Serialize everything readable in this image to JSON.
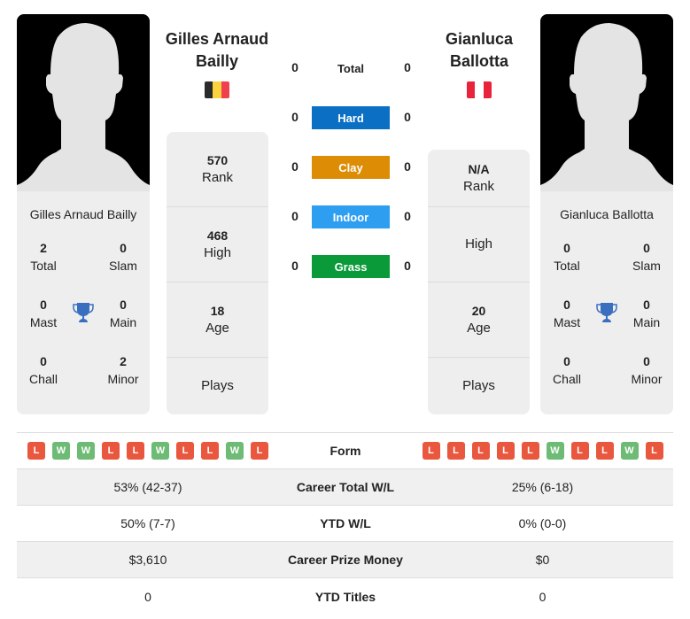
{
  "colors": {
    "hard": "#0b6fc4",
    "clay": "#dd8c05",
    "indoor": "#2e9ef0",
    "grass": "#0a9a3a",
    "win": "#6dbb75",
    "loss": "#e9573f",
    "trophy": "#3a6fbf"
  },
  "player1": {
    "name": "Gilles Arnaud Bailly",
    "name_line1": "Gilles Arnaud",
    "name_line2": "Bailly",
    "flag": "belgium-flag",
    "flag_colors": [
      "#2b2b2b",
      "#fbd33f",
      "#f0404f"
    ],
    "rank": "570",
    "rank_label": "Rank",
    "high": "468",
    "high_label": "High",
    "age": "18",
    "age_label": "Age",
    "plays": "",
    "plays_label": "Plays",
    "titles": {
      "total": "2",
      "total_label": "Total",
      "slam": "0",
      "slam_label": "Slam",
      "mast": "0",
      "mast_label": "Mast",
      "main": "0",
      "main_label": "Main",
      "chall": "0",
      "chall_label": "Chall",
      "minor": "2",
      "minor_label": "Minor"
    },
    "form": [
      "L",
      "W",
      "W",
      "L",
      "L",
      "W",
      "L",
      "L",
      "W",
      "L"
    ]
  },
  "player2": {
    "name": "Gianluca Ballotta",
    "name_line1": "Gianluca",
    "name_line2": "Ballotta",
    "flag": "peru-flag",
    "flag_colors": [
      "#e8233b",
      "#ffffff",
      "#e8233b"
    ],
    "rank": "N/A",
    "rank_label": "Rank",
    "high": "",
    "high_label": "High",
    "age": "20",
    "age_label": "Age",
    "plays": "",
    "plays_label": "Plays",
    "titles": {
      "total": "0",
      "total_label": "Total",
      "slam": "0",
      "slam_label": "Slam",
      "mast": "0",
      "mast_label": "Mast",
      "main": "0",
      "main_label": "Main",
      "chall": "0",
      "chall_label": "Chall",
      "minor": "0",
      "minor_label": "Minor"
    },
    "form": [
      "L",
      "L",
      "L",
      "L",
      "L",
      "W",
      "L",
      "L",
      "W",
      "L"
    ]
  },
  "h2h": {
    "total": {
      "label": "Total",
      "p1": "0",
      "p2": "0"
    },
    "hard": {
      "label": "Hard",
      "p1": "0",
      "p2": "0"
    },
    "clay": {
      "label": "Clay",
      "p1": "0",
      "p2": "0"
    },
    "indoor": {
      "label": "Indoor",
      "p1": "0",
      "p2": "0"
    },
    "grass": {
      "label": "Grass",
      "p1": "0",
      "p2": "0"
    }
  },
  "comparison": {
    "form_label": "Form",
    "rows": [
      {
        "label": "Career Total W/L",
        "p1": "53% (42-37)",
        "p2": "25% (6-18)"
      },
      {
        "label": "YTD W/L",
        "p1": "50% (7-7)",
        "p2": "0% (0-0)"
      },
      {
        "label": "Career Prize Money",
        "p1": "$3,610",
        "p2": "$0"
      },
      {
        "label": "YTD Titles",
        "p1": "0",
        "p2": "0"
      }
    ]
  }
}
